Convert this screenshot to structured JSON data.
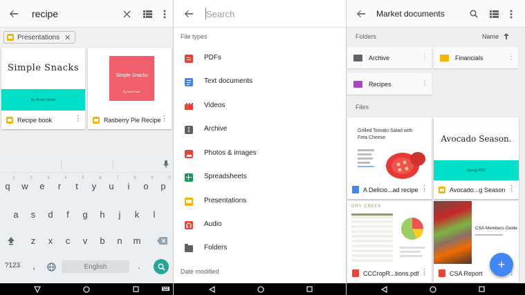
{
  "left_panel": {
    "search_query": "recipe",
    "filter_chip": "Presentations",
    "cards": [
      {
        "thumb_title": "Simple Snacks",
        "thumb_band_text": "By Shrine Rosie",
        "name": "Recipe book"
      },
      {
        "thumb_title": "Simple Snacks",
        "thumb_byline": "By Josie Parker",
        "name": "Rasberry Pie Recipe"
      }
    ],
    "keyboard": {
      "row1": [
        "q",
        "w",
        "e",
        "r",
        "t",
        "y",
        "u",
        "i",
        "o",
        "p"
      ],
      "row1_hints": [
        "1",
        "2",
        "3",
        "4",
        "5",
        "6",
        "7",
        "8",
        "9",
        "0"
      ],
      "row2": [
        "a",
        "s",
        "d",
        "f",
        "g",
        "h",
        "j",
        "k",
        "l"
      ],
      "row3": [
        "z",
        "x",
        "c",
        "v",
        "b",
        "n",
        "m"
      ],
      "symbols_key": "?123",
      "comma_key": ",",
      "space_label": "English",
      "period_key": "."
    }
  },
  "middle_panel": {
    "search_placeholder": "Search",
    "file_types_header": "File types",
    "file_types": [
      {
        "label": "PDFs",
        "icon": "pdf-icon",
        "color": "#ea4335"
      },
      {
        "label": "Text documents",
        "icon": "document-icon",
        "color": "#4285f4"
      },
      {
        "label": "Videos",
        "icon": "video-icon",
        "color": "#ea4335"
      },
      {
        "label": "Archive",
        "icon": "archive-icon",
        "color": "#616161"
      },
      {
        "label": "Photos & images",
        "icon": "image-icon",
        "color": "#ea4335"
      },
      {
        "label": "Spreadsheets",
        "icon": "spreadsheet-icon",
        "color": "#0f9d58"
      },
      {
        "label": "Presentations",
        "icon": "presentation-icon",
        "color": "#f4b400"
      },
      {
        "label": "Audio",
        "icon": "audio-icon",
        "color": "#ea4335"
      },
      {
        "label": "Folders",
        "icon": "folder-icon",
        "color": "#616161"
      }
    ],
    "date_modified_header": "Date modified"
  },
  "right_panel": {
    "title": "Market documents",
    "folders_header": "Folders",
    "sort_label": "Name",
    "folders": [
      {
        "name": "Archive",
        "color": "#5f6368"
      },
      {
        "name": "Financials",
        "color": "#f4b400"
      },
      {
        "name": "Recipes",
        "color": "#ab47bc"
      }
    ],
    "files_header": "Files",
    "files": [
      {
        "name": "A Delicio...ad recipe",
        "type": "document",
        "thumb_title": "Grilled Tomato Salad with Feta Cheese"
      },
      {
        "name": "Avocado...g Season",
        "type": "presentation",
        "thumb_title": "Avocado Season.",
        "thumb_band_text": "Spring 2015"
      },
      {
        "name": "CCCropR...tions.pdf",
        "type": "pdf",
        "thumb_title": "DRY CREEK"
      },
      {
        "name": "CSA Report",
        "type": "pdf",
        "thumb_title": "CSA Members Guide"
      }
    ]
  },
  "colors": {
    "teal_band": "#00e0c8",
    "accent_blue": "#4285f4",
    "slides_yellow": "#f4b400",
    "pdf_red": "#ea4335",
    "keyboard_action": "#26a69a"
  }
}
